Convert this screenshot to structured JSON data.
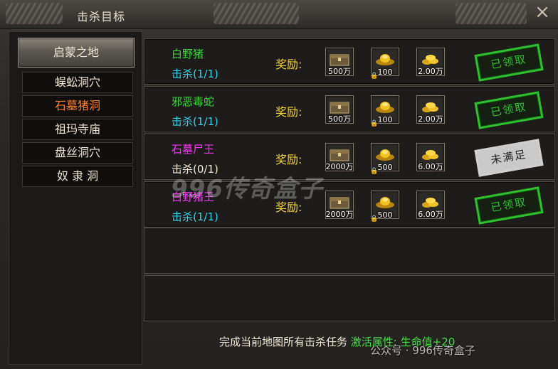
{
  "window": {
    "title": "击杀目标",
    "close_glyph": "×"
  },
  "region": {
    "label": "启蒙之地"
  },
  "maps": [
    {
      "label": "蜈蚣洞穴",
      "active": false
    },
    {
      "label": "石墓猪洞",
      "active": true
    },
    {
      "label": "祖玛寺庙",
      "active": false
    },
    {
      "label": "盘丝洞穴",
      "active": false
    },
    {
      "label": "奴 隶 洞",
      "active": false
    }
  ],
  "reward_label": "奖励:",
  "targets": [
    {
      "name": "白野猪",
      "name_color": "#33d933",
      "kill": "击杀(1/1)",
      "kill_color": "#35d1e8",
      "rewards": [
        "500万",
        "100",
        "2.00万"
      ],
      "status": "已领取",
      "status_type": "done"
    },
    {
      "name": "邪恶毒蛇",
      "name_color": "#33d933",
      "kill": "击杀(1/1)",
      "kill_color": "#35d1e8",
      "rewards": [
        "500万",
        "100",
        "2.00万"
      ],
      "status": "已领取",
      "status_type": "done"
    },
    {
      "name": "石墓尸王",
      "name_color": "#ff33ff",
      "kill": "击杀(0/1)",
      "kill_color": "#f1ead6",
      "rewards": [
        "2000万",
        "500",
        "6.00万"
      ],
      "status": "未满足",
      "status_type": "notyet"
    },
    {
      "name": "白野猪王",
      "name_color": "#ff33ff",
      "kill": "击杀(1/1)",
      "kill_color": "#35d1e8",
      "rewards": [
        "2000万",
        "500",
        "6.00万"
      ],
      "status": "已领取",
      "status_type": "done"
    }
  ],
  "footer": {
    "text": "完成当前地图所有击杀任务",
    "activate": "激活属性:",
    "bonus": "生命值+20"
  },
  "watermark": "996传奇盒子",
  "credit": "公众号 · 996传奇盒子",
  "colors": {
    "footer_green": "#3fe23f",
    "map_active": "#ff7d2a",
    "reward_yellow": "#f4d23a"
  },
  "icons": [
    "chest-icon",
    "gold-ingot-icon",
    "gold-coins-icon",
    "lock-icon",
    "close-icon"
  ]
}
